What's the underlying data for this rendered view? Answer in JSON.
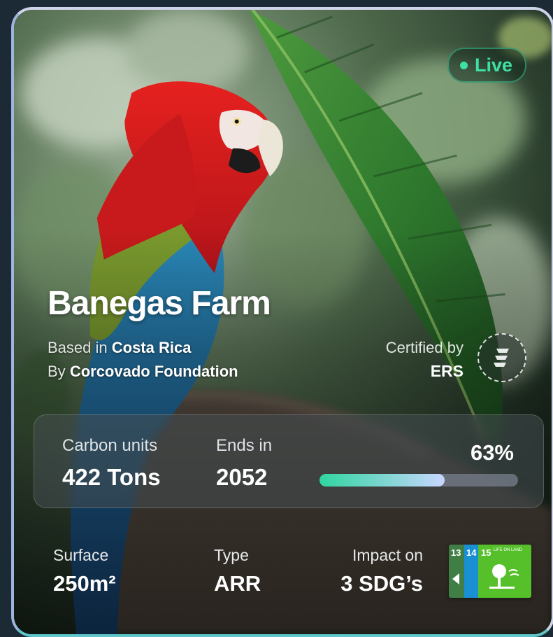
{
  "status": {
    "label": "Live",
    "color": "#3ee0a3"
  },
  "project": {
    "title": "Banegas Farm",
    "based_prefix": "Based in",
    "country": "Costa Rica",
    "by_prefix": "By",
    "organization": "Corcovado Foundation"
  },
  "certification": {
    "label": "Certified by",
    "certifier": "ERS",
    "icon": "ers-logo-icon"
  },
  "stats": {
    "carbon_label": "Carbon units",
    "carbon_value": "422 Tons",
    "ends_label": "Ends in",
    "ends_value": "2052",
    "progress_label": "63%",
    "progress_fraction": 0.63
  },
  "details": {
    "surface_label": "Surface",
    "surface_value": "250m²",
    "type_label": "Type",
    "type_value": "ARR",
    "impact_label": "Impact on",
    "impact_value": "3 SDG’s",
    "sdg_numbers": [
      "13",
      "14",
      "15"
    ],
    "sdg_15_caption": "LIFE ON LAND"
  }
}
